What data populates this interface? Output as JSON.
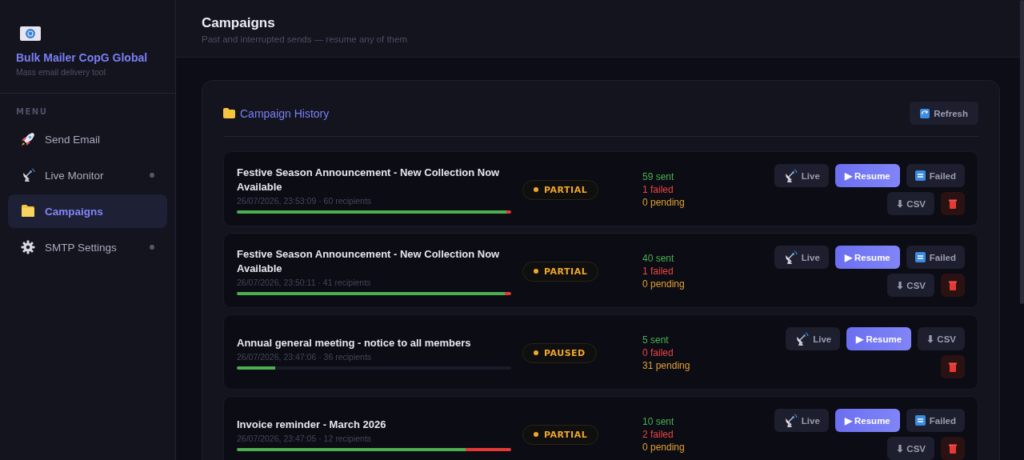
{
  "sidebar": {
    "app_name": "Bulk Mailer CopG Global",
    "tagline": "Mass email delivery tool",
    "menu_label": "MENU",
    "items": [
      {
        "kind": "rocket",
        "label": "Send Email",
        "selected": false,
        "indicator": false
      },
      {
        "kind": "satellite",
        "label": "Live Monitor",
        "selected": false,
        "indicator": true
      },
      {
        "kind": "folder",
        "label": "Campaigns",
        "selected": true,
        "indicator": false
      },
      {
        "kind": "gear",
        "label": "SMTP Settings",
        "selected": false,
        "indicator": true
      }
    ]
  },
  "header": {
    "title": "Campaigns",
    "subtitle": "Past and interrupted sends — resume any of them"
  },
  "panel": {
    "title": "Campaign History",
    "refresh": "Refresh",
    "campaigns": [
      {
        "name": "Festive Season Announcement - New Collection Now Available",
        "meta": "26/07/2026, 23:53:09 · 60 recipients",
        "status": "PARTIAL",
        "sent": "59 sent",
        "failed": "1 failed",
        "pending": "0 pending",
        "progress": [
          {
            "kind": "sent",
            "level": 0.983
          },
          {
            "kind": "failed",
            "level": 0.017
          }
        ],
        "actions": [
          {
            "kind": "live",
            "label": "Live"
          },
          {
            "kind": "resume",
            "label": "▶ Resume"
          },
          {
            "kind": "failed",
            "label": "Failed"
          },
          {
            "kind": "csv",
            "label": "⬇ CSV"
          },
          {
            "kind": "delete"
          }
        ]
      },
      {
        "name": "Festive Season Announcement - New Collection Now Available",
        "meta": "26/07/2026, 23:50:11 · 41 recipients",
        "status": "PARTIAL",
        "sent": "40 sent",
        "failed": "1 failed",
        "pending": "0 pending",
        "progress": [
          {
            "kind": "sent",
            "level": 0.976
          },
          {
            "kind": "failed",
            "level": 0.024
          }
        ],
        "actions": [
          {
            "kind": "live",
            "label": "Live"
          },
          {
            "kind": "resume",
            "label": "▶ Resume"
          },
          {
            "kind": "failed",
            "label": "Failed"
          },
          {
            "kind": "csv",
            "label": "⬇ CSV"
          },
          {
            "kind": "delete"
          }
        ]
      },
      {
        "name": "Annual general meeting - notice to all members",
        "meta": "26/07/2026, 23:47:06 · 36 recipients",
        "status": "PAUSED",
        "sent": "5 sent",
        "failed": "0 failed",
        "pending": "31 pending",
        "progress": [
          {
            "kind": "sent",
            "level": 0.139
          }
        ],
        "actions": [
          {
            "kind": "live",
            "label": "Live"
          },
          {
            "kind": "resume",
            "label": "▶ Resume"
          },
          {
            "kind": "csv",
            "label": "⬇ CSV"
          },
          {
            "kind": "delete"
          }
        ]
      },
      {
        "name": "Invoice reminder - March 2026",
        "meta": "26/07/2026, 23:47:05 · 12 recipients",
        "status": "PARTIAL",
        "sent": "10 sent",
        "failed": "2 failed",
        "pending": "0 pending",
        "progress": [
          {
            "kind": "sent",
            "level": 0.833
          },
          {
            "kind": "failed",
            "level": 0.167
          }
        ],
        "actions": [
          {
            "kind": "live",
            "label": "Live"
          },
          {
            "kind": "resume",
            "label": "▶ Resume"
          },
          {
            "kind": "failed",
            "label": "Failed"
          },
          {
            "kind": "csv",
            "label": "⬇ CSV"
          },
          {
            "kind": "delete"
          }
        ]
      }
    ]
  }
}
